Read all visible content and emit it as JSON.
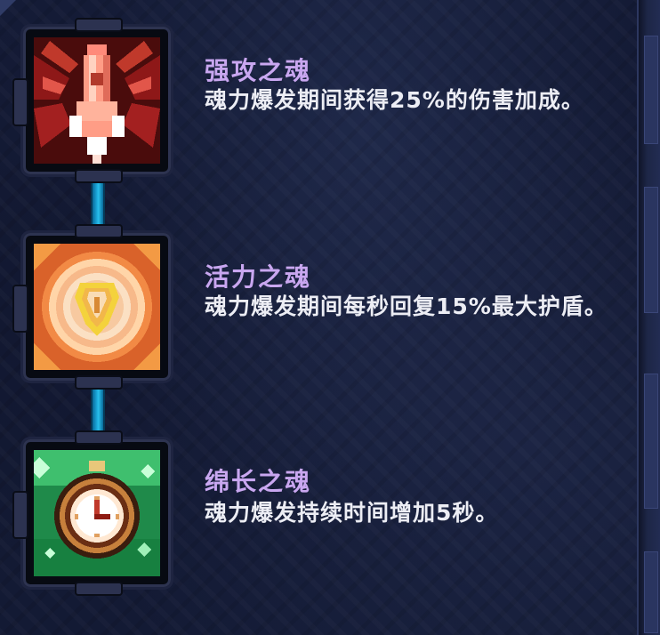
{
  "skills": [
    {
      "icon": "red-rocket-icon",
      "name": "强攻之魂",
      "description": "魂力爆发期间获得25%的伤害加成。",
      "color": "#c0392b"
    },
    {
      "icon": "orange-shield-icon",
      "name": "活力之魂",
      "description": "魂力爆发期间每秒回复15%最大护盾。",
      "color": "#e67e22"
    },
    {
      "icon": "green-clock-icon",
      "name": "绵长之魂",
      "description": "魂力爆发持续时间增加5秒。",
      "color": "#27ae60"
    }
  ],
  "colors": {
    "title": "#c9a7f0",
    "description": "#ecedf4",
    "connector": "#1aa6d8",
    "background": "#131a33"
  }
}
